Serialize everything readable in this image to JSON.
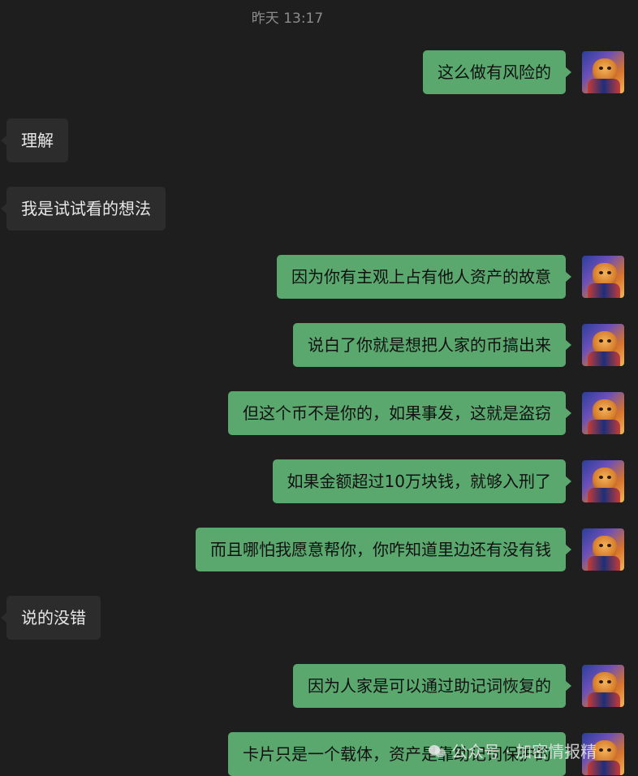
{
  "timestamp": "昨天 13:17",
  "messages": [
    {
      "dir": "out",
      "text": "这么做有风险的"
    },
    {
      "dir": "in",
      "text": "理解"
    },
    {
      "dir": "in",
      "text": "我是试试看的想法"
    },
    {
      "dir": "out",
      "text": "因为你有主观上占有他人资产的故意"
    },
    {
      "dir": "out",
      "text": "说白了你就是想把人家的币搞出来"
    },
    {
      "dir": "out",
      "text": "但这个币不是你的，如果事发，这就是盗窃"
    },
    {
      "dir": "out",
      "text": "如果金额超过10万块钱，就够入刑了"
    },
    {
      "dir": "out",
      "text": "而且哪怕我愿意帮你，你咋知道里边还有没有钱"
    },
    {
      "dir": "in",
      "text": "说的没错"
    },
    {
      "dir": "out",
      "text": "因为人家是可以通过助记词恢复的"
    },
    {
      "dir": "out",
      "text": "卡片只是一个载体，资产是靠助记词保护的"
    }
  ],
  "watermark": "公众号 · 加密情报精",
  "colors": {
    "background": "#1e1e1e",
    "outgoing_bubble": "#5aa86e",
    "incoming_bubble": "#2c2c2c"
  },
  "icons": {
    "avatar": "cat-avatar-icon",
    "watermark": "wechat-icon"
  }
}
